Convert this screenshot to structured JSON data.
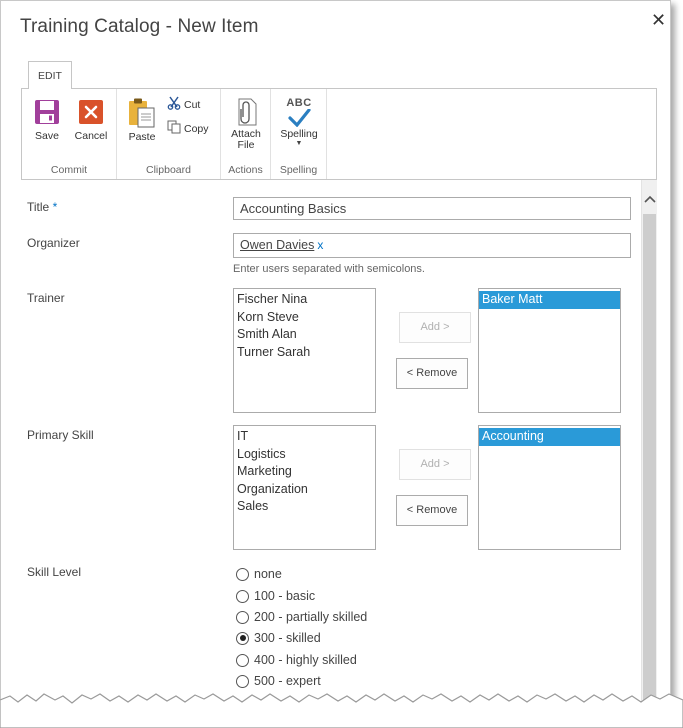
{
  "dialog": {
    "title": "Training Catalog - New Item",
    "close_glyph": "✕"
  },
  "ribbon": {
    "tab": "EDIT",
    "groups": {
      "commit": "Commit",
      "clipboard": "Clipboard",
      "actions": "Actions",
      "spelling": "Spelling"
    },
    "buttons": {
      "save": "Save",
      "cancel": "Cancel",
      "paste": "Paste",
      "cut": "Cut",
      "copy": "Copy",
      "attach_line1": "Attach",
      "attach_line2": "File",
      "spelling": "Spelling",
      "spelling_icon_text": "ABC"
    }
  },
  "form": {
    "title_label": "Title",
    "required_mark": " *",
    "title_value": "Accounting Basics",
    "organizer_label": "Organizer",
    "organizer_value": "Owen Davies",
    "organizer_remove": "x",
    "organizer_hint": "Enter users separated with semicolons.",
    "trainer_label": "Trainer",
    "trainer_available": [
      "Fischer Nina",
      "Korn Steve",
      "Smith Alan",
      "Turner Sarah"
    ],
    "trainer_selected": [
      "Baker Matt"
    ],
    "add_label": "Add >",
    "remove_label": "< Remove",
    "skill_label": "Primary Skill",
    "skill_available": [
      "IT",
      "Logistics",
      "Marketing",
      "Organization",
      "Sales"
    ],
    "skill_selected": [
      "Accounting"
    ],
    "level_label": "Skill Level",
    "levels": [
      "none",
      "100 - basic",
      "200 - partially skilled",
      "300 - skilled",
      "400 - highly skilled",
      "500 - expert"
    ],
    "level_selected": "300 - skilled"
  },
  "colors": {
    "accent": "#0072c6",
    "selection": "#2a9ad8",
    "save_icon": "#a13f9b",
    "cancel_icon": "#d9522a"
  }
}
